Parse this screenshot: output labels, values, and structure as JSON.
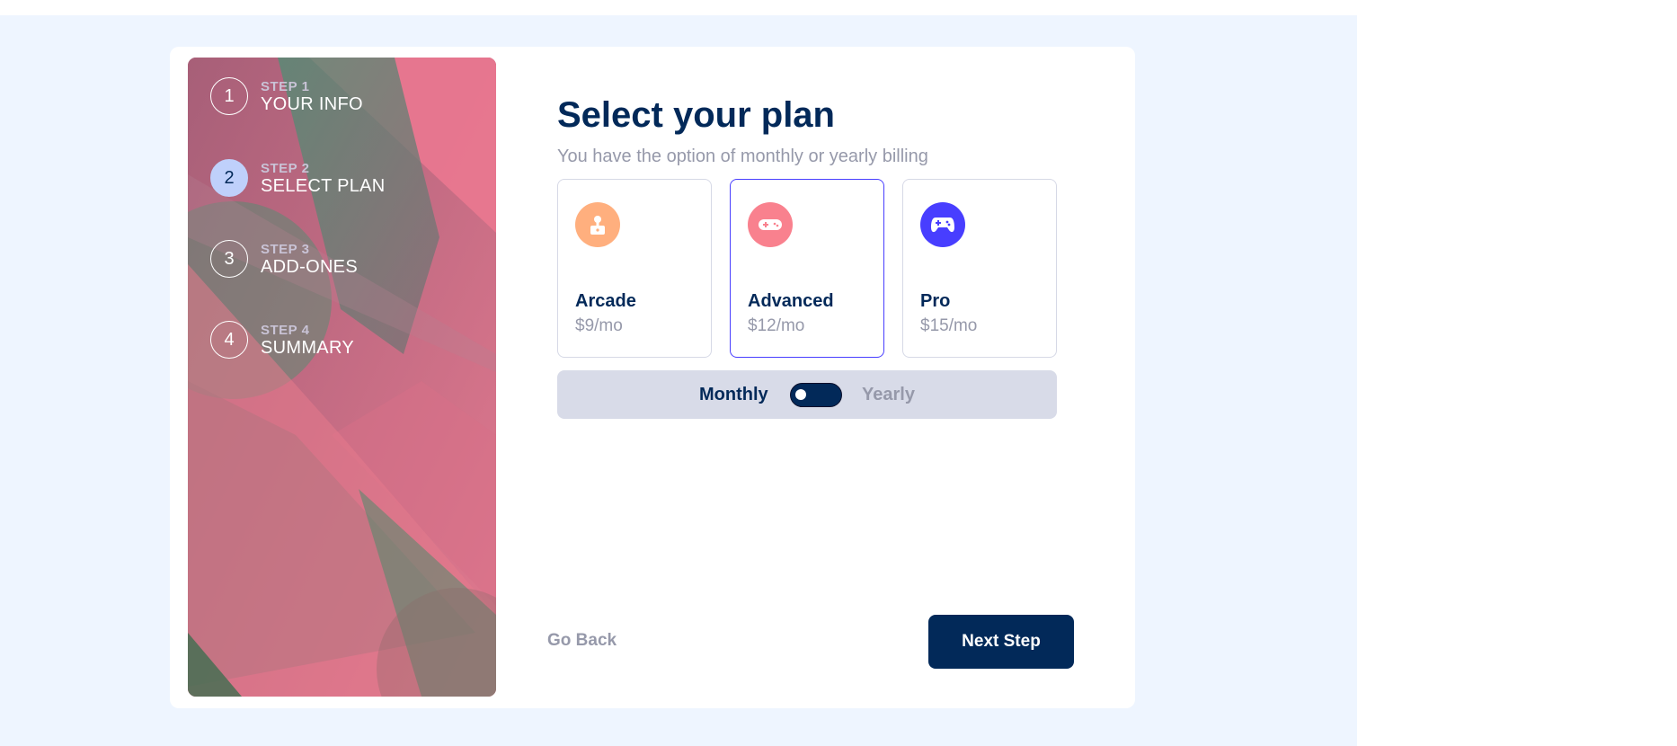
{
  "steps": [
    {
      "number": "1",
      "kicker": "STEP 1",
      "title": "YOUR INFO",
      "active": false
    },
    {
      "number": "2",
      "kicker": "STEP 2",
      "title": "SELECT PLAN",
      "active": true
    },
    {
      "number": "3",
      "kicker": "STEP 3",
      "title": "ADD-ONES",
      "active": false
    },
    {
      "number": "4",
      "kicker": "STEP 4",
      "title": "SUMMARY",
      "active": false
    }
  ],
  "main": {
    "heading": "Select your plan",
    "subheading": "You have the option of monthly or yearly billing"
  },
  "plans": [
    {
      "name": "Arcade",
      "price": "$9/mo",
      "icon": "arcade-icon",
      "color": "#ffaf7e",
      "selected": false
    },
    {
      "name": "Advanced",
      "price": "$12/mo",
      "icon": "advanced-controller-icon",
      "color": "#f9818e",
      "selected": true
    },
    {
      "name": "Pro",
      "price": "$15/mo",
      "icon": "pro-gamepad-icon",
      "color": "#483eff",
      "selected": false
    }
  ],
  "billing": {
    "monthly_label": "Monthly",
    "yearly_label": "Yearly",
    "selected": "Monthly"
  },
  "nav": {
    "back_label": "Go Back",
    "next_label": "Next Step"
  },
  "colors": {
    "primary": "#022959",
    "accent": "#483eff",
    "muted": "#9699aa",
    "background": "#eef5ff"
  }
}
